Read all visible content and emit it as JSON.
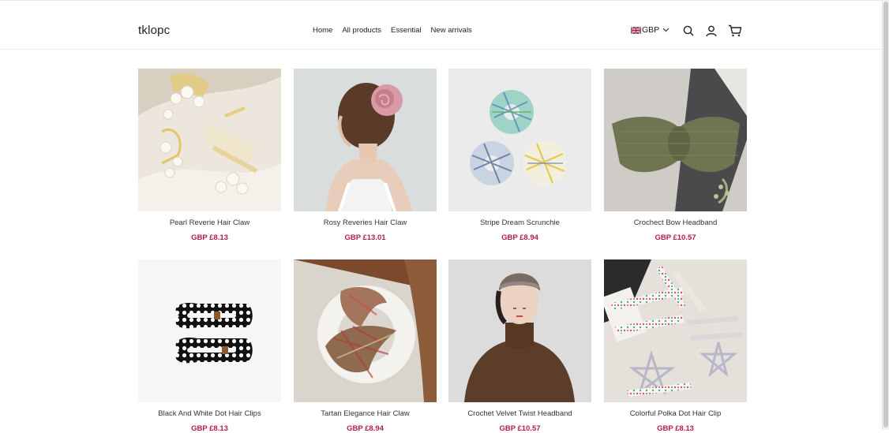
{
  "header": {
    "logo": "tklopc",
    "nav": [
      "Home",
      "All products",
      "Essential",
      "New arrivals"
    ],
    "currency": "GBP"
  },
  "products": [
    {
      "name": "Pearl Reverie Hair Claw",
      "price": "GBP £8.13"
    },
    {
      "name": "Rosy Reveries Hair Claw",
      "price": "GBP £13.01"
    },
    {
      "name": "Stripe Dream Scrunchie",
      "price": "GBP £8.94"
    },
    {
      "name": "Crochect Bow Headband",
      "price": "GBP £10.57"
    },
    {
      "name": "Black And White Dot Hair Clips",
      "price": "GBP £8.13"
    },
    {
      "name": "Tartan Elegance Hair Claw",
      "price": "GBP £8.94"
    },
    {
      "name": "Crochet Velvet Twist Headband",
      "price": "GBP £10.57"
    },
    {
      "name": "Colorful Polka Dot Hair Clip",
      "price": "GBP £8.13"
    }
  ],
  "colors": {
    "price": "#b01e48"
  },
  "icons": [
    "uk-flag-icon",
    "chevron-down-icon",
    "search-icon",
    "account-icon",
    "cart-icon"
  ]
}
